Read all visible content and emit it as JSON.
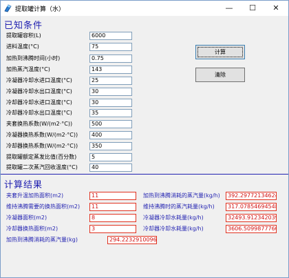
{
  "window": {
    "title": "提取罐计算（水）",
    "minimize_glyph": "—",
    "maximize_glyph": "☐",
    "close_glyph": "✕"
  },
  "known": {
    "section_title": "已知条件",
    "fields": [
      {
        "label": "提取罐容积(L)",
        "value": "6000"
      },
      {
        "label": "进料温度(°C)",
        "value": "75"
      },
      {
        "label": "加热到沸腾时间(小时)",
        "value": "0.75"
      },
      {
        "label": "加热蒸汽温度(°C)",
        "value": "143"
      },
      {
        "label": "冷凝器冷却水进口温度(°C)",
        "value": "25"
      },
      {
        "label": "冷凝器冷却水出口温度(°C)",
        "value": "30"
      },
      {
        "label": "冷却器冷却水进口温度(°C)",
        "value": "30"
      },
      {
        "label": "冷却器冷却水出口温度(°C)",
        "value": "35"
      },
      {
        "label": "夹套换热系数(W/(m2·°C))",
        "value": "500"
      },
      {
        "label": "冷凝器换热系数(W/(m2·°C))",
        "value": "400"
      },
      {
        "label": "冷却器换热系数(W/(m2·°C))",
        "value": "350"
      },
      {
        "label": "提取罐额定蒸发比值(百分数)",
        "value": "5"
      },
      {
        "label": "提取罐二次蒸汽回收温度(°C)",
        "value": "40"
      }
    ],
    "calc_button": "计算",
    "clear_button": "清除"
  },
  "results": {
    "section_title": "计算结果",
    "left": [
      {
        "label": "夹套升温加热面积(m2)",
        "value": "11"
      },
      {
        "label": "维持沸腾需要的换热面积(m2)",
        "value": "11"
      },
      {
        "label": "冷凝器面积(m2)",
        "value": "8"
      },
      {
        "label": "冷却器换热面积(m2)",
        "value": "3"
      },
      {
        "label": "加热到沸腾消耗的蒸汽量(kg)",
        "value": "294.223291009686"
      }
    ],
    "right": [
      {
        "label": "加热到沸腾消耗的蒸汽量(kg/h)",
        "value": "392.297721346247"
      },
      {
        "label": "维持沸腾时的蒸汽耗量(kg/h)",
        "value": "317.078546945483"
      },
      {
        "label": "冷凝器冷却水耗量(kg/h)",
        "value": "32493.9123420397"
      },
      {
        "label": "冷却器冷却水耗量(kg/h)",
        "value": "3606.50998777603"
      }
    ]
  }
}
